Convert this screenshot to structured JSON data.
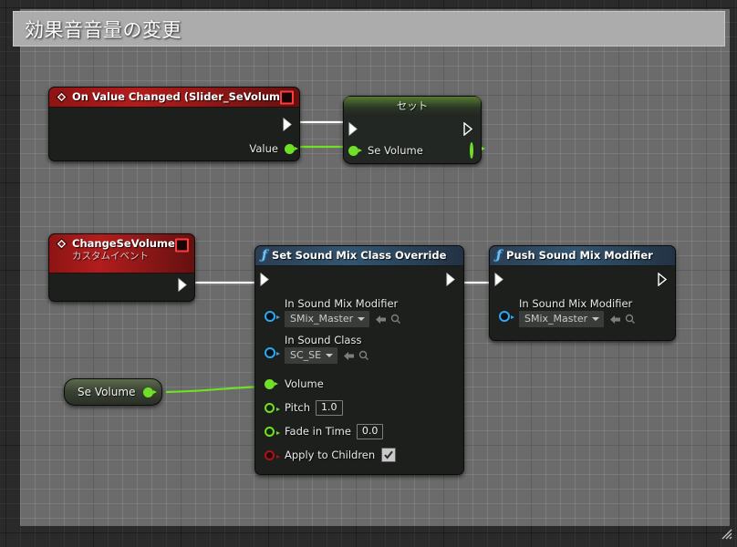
{
  "window": {
    "title": "効果音音量の変更"
  },
  "graph": {
    "nodes": [
      {
        "id": "on-value-changed",
        "kind": "event",
        "title": "On Value Changed (Slider_SeVolume)",
        "icon": "event-diamond-icon",
        "delegate_pin": "delegate-output-pin",
        "exec_out_label": "",
        "outputs": [
          {
            "label": "Value",
            "type": "float",
            "connected": true
          }
        ]
      },
      {
        "id": "set-se-volume",
        "kind": "set",
        "title": "セット",
        "inputs": [
          {
            "label": "Se Volume",
            "type": "float",
            "connected": true
          }
        ],
        "outputs": [
          {
            "label": "",
            "type": "float",
            "connected": false
          }
        ]
      },
      {
        "id": "change-se-volume",
        "kind": "custom-event",
        "title": "ChangeSeVolume",
        "subtitle": "カスタムイベント",
        "icon": "event-diamond-icon",
        "delegate_pin": "delegate-output-pin"
      },
      {
        "id": "set-sound-mix-class-override",
        "kind": "function",
        "title": "Set Sound Mix Class Override",
        "icon": "function-f-icon",
        "inputs": [
          {
            "label": "In Sound Mix Modifier",
            "type": "object",
            "value": "SMix_Master",
            "widget": "dropdown"
          },
          {
            "label": "In Sound Class",
            "type": "object",
            "value": "SC_SE",
            "widget": "dropdown"
          },
          {
            "label": "Volume",
            "type": "float",
            "connected": true
          },
          {
            "label": "Pitch",
            "type": "float",
            "value": "1.0",
            "widget": "textbox"
          },
          {
            "label": "Fade in Time",
            "type": "float",
            "value": "0.0",
            "widget": "textbox"
          },
          {
            "label": "Apply to Children",
            "type": "bool",
            "value": "checked",
            "widget": "checkbox"
          }
        ]
      },
      {
        "id": "push-sound-mix-modifier",
        "kind": "function",
        "title": "Push Sound Mix Modifier",
        "icon": "function-f-icon",
        "inputs": [
          {
            "label": "In Sound Mix Modifier",
            "type": "object",
            "value": "SMix_Master",
            "widget": "dropdown"
          }
        ]
      },
      {
        "id": "get-se-volume",
        "kind": "variable-get",
        "title": "Se Volume",
        "outputs": [
          {
            "label": "",
            "type": "float",
            "connected": true
          }
        ]
      }
    ],
    "colors": {
      "exec_wire": "#ffffff",
      "float_wire": "#6fe026",
      "event_header": "#b21d1d",
      "function_header": "#33556f",
      "set_header": "#7dbe3c",
      "object_pin": "#2ea8ef",
      "bool_pin": "#aa1414"
    }
  },
  "texts": {
    "on_value_changed_title": "On Value Changed (Slider_SeVolume)",
    "value_label": "Value",
    "set_title": "セット",
    "se_volume_label": "Se Volume",
    "change_se_volume_title": "ChangeSeVolume",
    "custom_event_subtitle": "カスタムイベント",
    "set_sound_mix_title": "Set Sound Mix Class Override",
    "push_sound_mix_title": "Push Sound Mix Modifier",
    "in_sound_mix_modifier": "In Sound Mix Modifier",
    "in_sound_class": "In Sound Class",
    "volume": "Volume",
    "pitch": "Pitch",
    "fade_in_time": "Fade in Time",
    "apply_to_children": "Apply to Children",
    "smix_master": "SMix_Master",
    "sc_se": "SC_SE",
    "pitch_value": "1.0",
    "fade_in_time_value": "0.0",
    "getter_se_volume": "Se Volume"
  }
}
